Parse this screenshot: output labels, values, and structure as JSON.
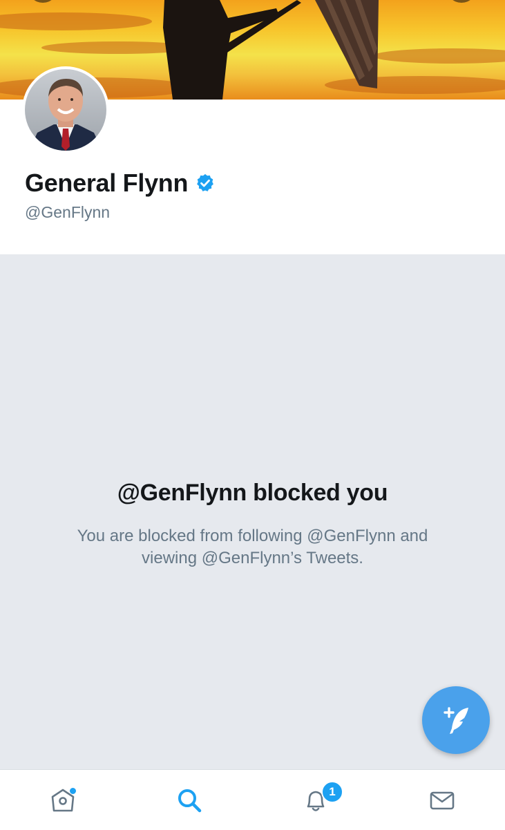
{
  "profile": {
    "display_name": "General Flynn",
    "handle": "@GenFlynn",
    "verified": true
  },
  "blocked": {
    "title": "@GenFlynn blocked you",
    "description": "You are blocked from following @GenFlynn and viewing @GenFlynn’s Tweets."
  },
  "tabbar": {
    "tabs": [
      {
        "icon": "home-icon",
        "selected": false,
        "new_dot": true
      },
      {
        "icon": "search-icon",
        "selected": true
      },
      {
        "icon": "notifications-icon",
        "selected": false,
        "badge": "1"
      },
      {
        "icon": "messages-icon",
        "selected": false
      }
    ]
  },
  "compose": {
    "icon": "compose-tweet-icon"
  },
  "colors": {
    "accent": "#1da1f2",
    "fab": "#4aa1eb",
    "blocked_background": "#e6e9ee",
    "secondary_text": "#657786",
    "primary_text": "#14171a"
  }
}
